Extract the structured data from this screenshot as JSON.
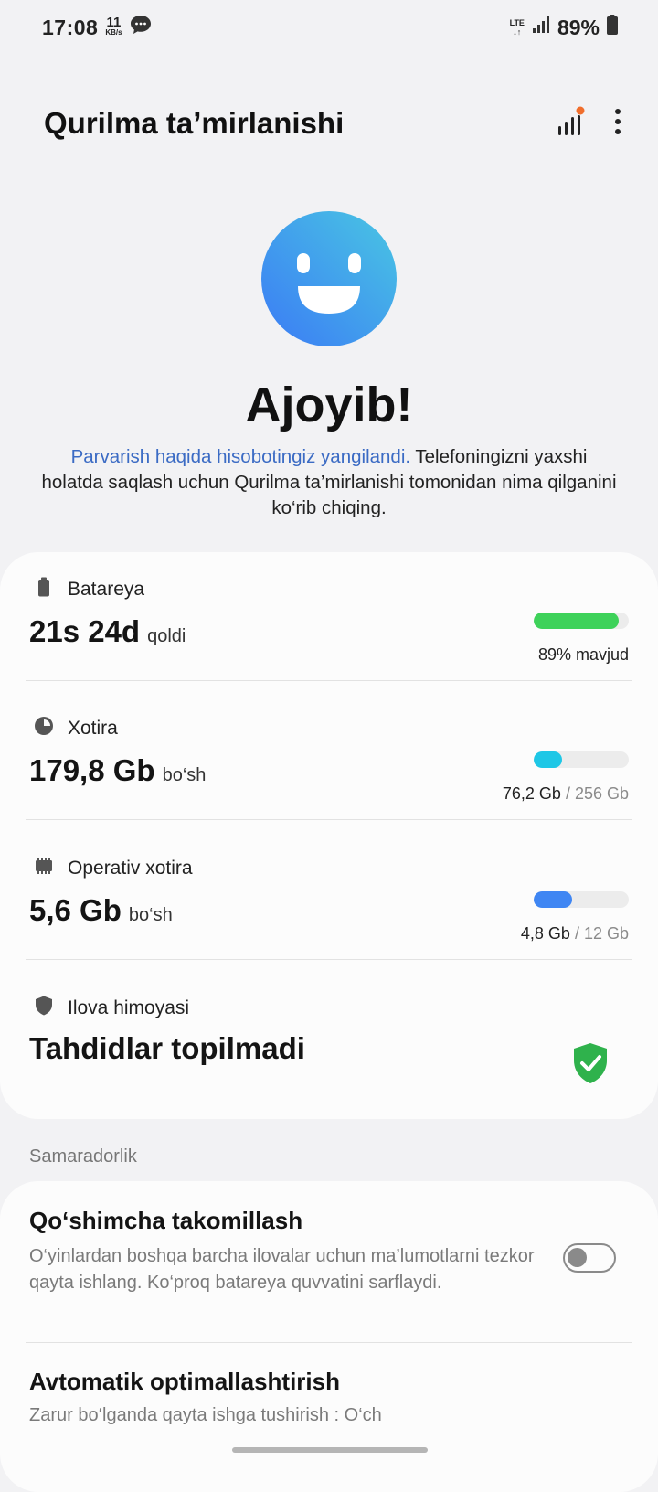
{
  "status_bar": {
    "time": "17:08",
    "net_speed_value": "11",
    "net_speed_unit": "KB/s",
    "network": "LTE",
    "battery_percent": "89%"
  },
  "app_bar": {
    "title": "Qurilma ta’mirlanishi",
    "icons": [
      "report-bars-icon",
      "more-options-icon"
    ],
    "notification_dot_color": "#f06e2c"
  },
  "hero": {
    "title": "Ajoyib!",
    "link_text": "Parvarish haqida hisobotingiz yangilandi.",
    "description": " Telefoningizni yaxshi holatda saqlash uchun Qurilma ta’mirlanishi tomonidan nima qilganini ko‘rib chiqing."
  },
  "sections": {
    "battery": {
      "label": "Batareya",
      "value": "21s 24d",
      "value_suffix": "qoldi",
      "meta": "89% mavjud",
      "fill": 0.89,
      "color": "#3ed25a"
    },
    "storage": {
      "label": "Xotira",
      "value": "179,8 Gb",
      "value_suffix": "bo‘sh",
      "used": "76,2 Gb",
      "total": "/ 256 Gb",
      "fill": 0.298,
      "color": "#1ec7e6"
    },
    "ram": {
      "label": "Operativ xotira",
      "value": "5,6 Gb",
      "value_suffix": "bo‘sh",
      "used": "4,8 Gb",
      "total": "/ 12 Gb",
      "fill": 0.4,
      "color": "#3f86f3"
    },
    "app_protection": {
      "label": "Ilova himoyasi",
      "value": "Tahdidlar topilmadi",
      "color": "#2fb24c"
    }
  },
  "performance": {
    "header": "Samaradorlik",
    "enhanced": {
      "title": "Qo‘shimcha takomillash",
      "description": "O‘yinlardan boshqa barcha ilovalar uchun ma’lumotlarni tezkor qayta ishlang. Ko‘proq batareya quvvatini sarflaydi.",
      "enabled": false
    },
    "auto_optimize": {
      "title": "Avtomatik optimallashtirish",
      "description": "Zarur bo‘lganda qayta ishga tushirish : O‘ch"
    }
  }
}
